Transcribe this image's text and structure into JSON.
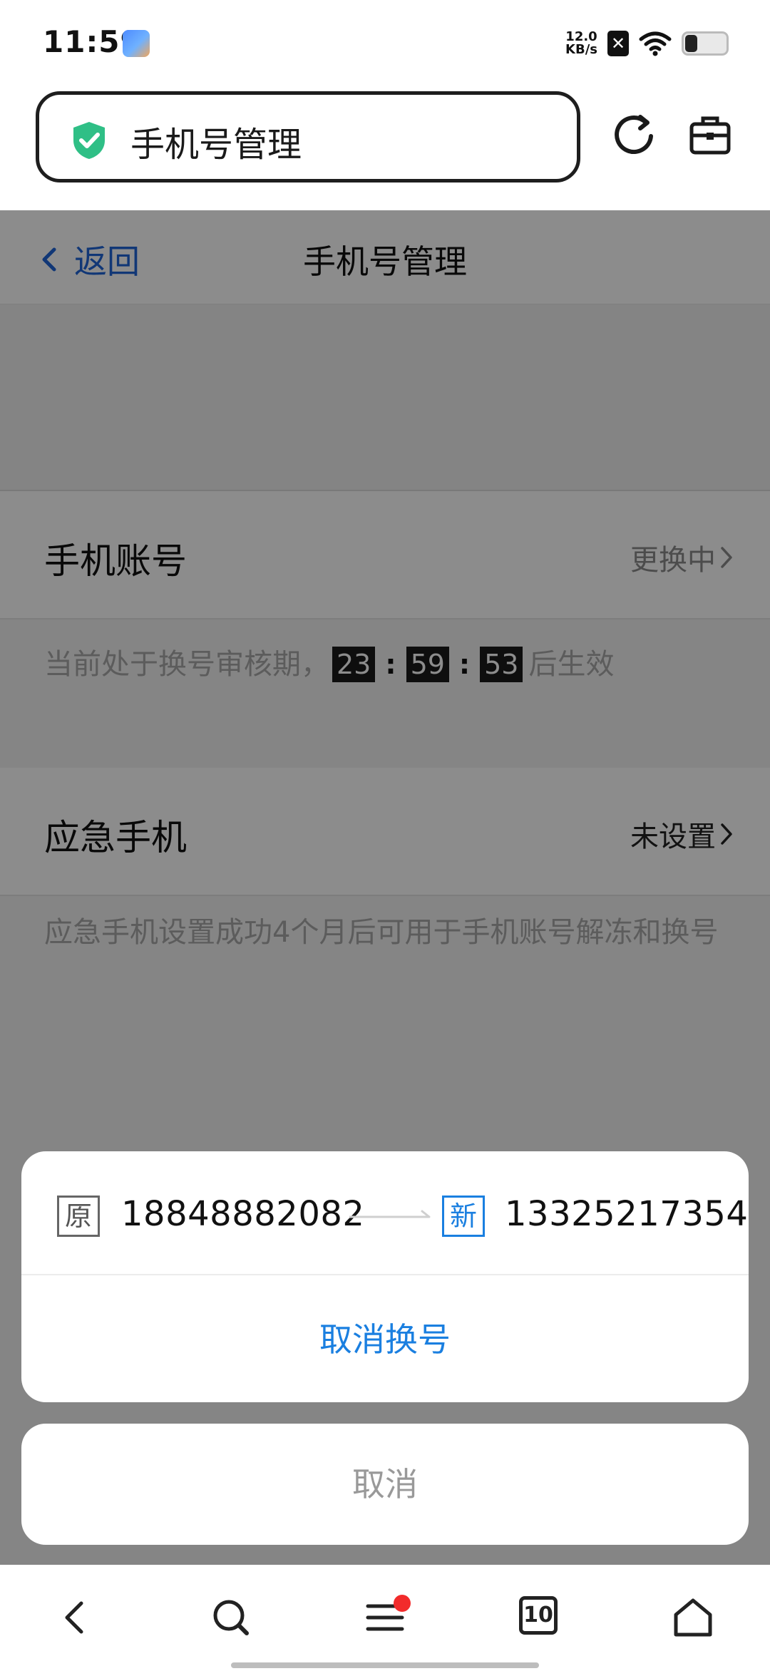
{
  "status_bar": {
    "time": "11:59",
    "net_speed_value": "12.0",
    "net_speed_unit": "KB/s",
    "sim_glyph": "✕",
    "battery_level_percent": 30
  },
  "browser": {
    "url_title": "手机号管理",
    "tab_count": "10"
  },
  "page": {
    "back_label": "返回",
    "title": "手机号管理",
    "account_row": {
      "label": "手机账号",
      "value": "更换中"
    },
    "review_note": {
      "prefix": "当前处于换号审核期，",
      "hours": "23",
      "minutes": "59",
      "seconds": "53",
      "sep": ":",
      "suffix": "后生效"
    },
    "emergency_row": {
      "label": "应急手机",
      "value": "未设置"
    },
    "emergency_note": "应急手机设置成功4个月后可用于手机账号解冻和换号"
  },
  "sheet": {
    "old_tag": "原",
    "old_number": "18848882082",
    "new_tag": "新",
    "new_number": "13325217354",
    "cancel_change_label": "取消换号",
    "cancel_label": "取消"
  },
  "colors": {
    "link_blue": "#1f64d8",
    "action_blue": "#1a7fe0",
    "shield_green": "#2fbf86",
    "badge_red": "#f22b2b"
  }
}
